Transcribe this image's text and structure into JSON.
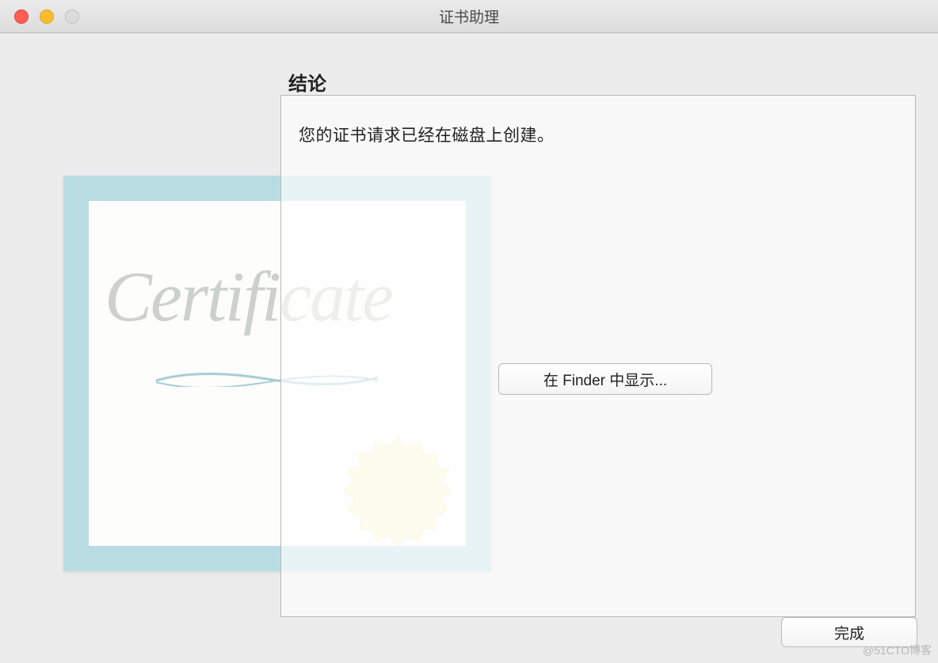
{
  "window": {
    "title": "证书助理"
  },
  "section": {
    "heading": "结论"
  },
  "panel": {
    "message": "您的证书请求已经在磁盘上创建。",
    "show_in_finder_label": "在 Finder 中显示..."
  },
  "certificate_bg": {
    "script_text": "Certificate"
  },
  "footer": {
    "done_label": "完成"
  },
  "watermark": "@51CTO博客"
}
